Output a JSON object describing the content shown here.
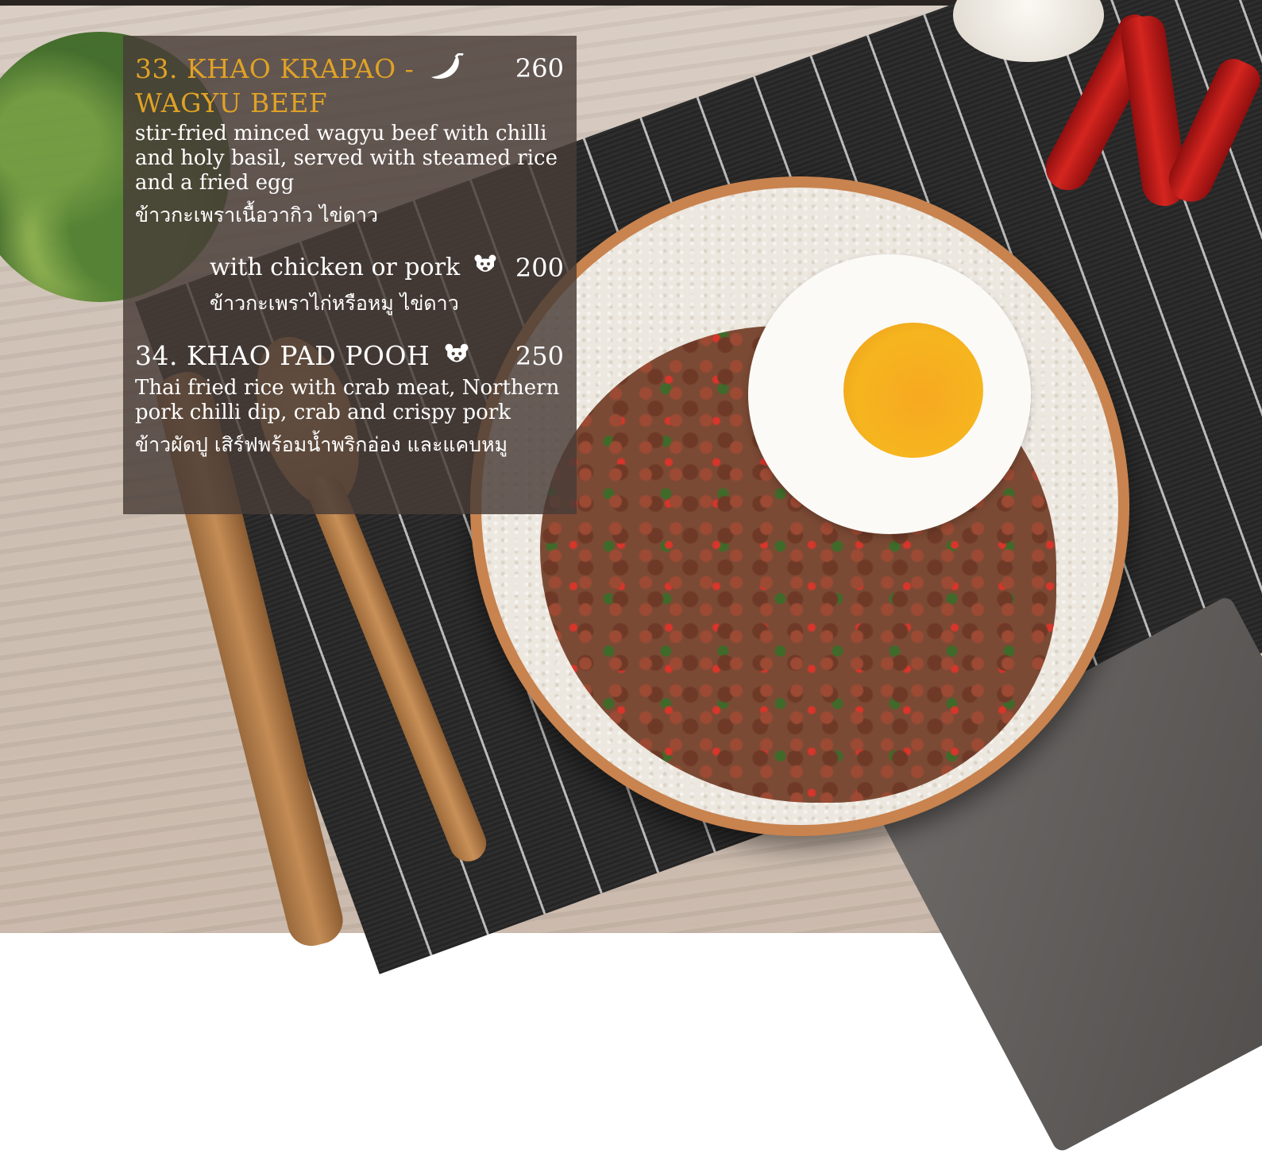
{
  "menu": {
    "items": [
      {
        "number_title": "33. KHAO KRAPAO -",
        "title_line2": "WAGYU BEEF",
        "price": "260",
        "description": "stir-fried minced wagyu beef with chilli and holy basil, served with steamed rice and a fried egg",
        "thai": "ข้าวกะเพราเนื้อวากิว ไข่ดาว",
        "icon": "chilli-icon",
        "variant": {
          "label": "with chicken or pork",
          "price": "200",
          "thai": "ข้าวกะเพราไก่หรือหมู ไข่ดาว",
          "icon": "bear-icon"
        }
      },
      {
        "number_title": "34. KHAO PAD POOH",
        "price": "250",
        "description": "Thai fried rice with crab meat, Northern pork chilli dip, crab and crispy pork",
        "thai": "ข้าวผัดปู เสิร์ฟพร้อมน้ำพริกอ่อง และแคบหมู",
        "icon": "bear-icon"
      }
    ]
  },
  "colors": {
    "title_gold": "#e0a226",
    "panel_overlay": "rgba(72,60,55,0.82)",
    "text": "#ffffff"
  }
}
